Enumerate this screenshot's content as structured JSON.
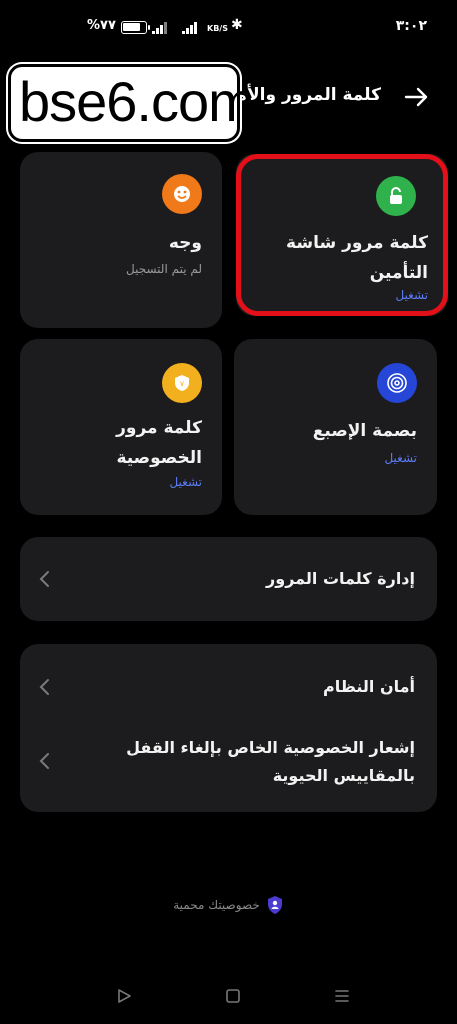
{
  "status_bar": {
    "time": "٣:٠٢",
    "battery": "%٧٧",
    "battery_level": 0.77,
    "net_speed_top": "KB/S",
    "net_speed_bottom": ""
  },
  "header": {
    "title": "كلمة المرور والأمان",
    "back_icon": "arrow-right-icon"
  },
  "watermark": {
    "text": "bse6.com"
  },
  "tiles": {
    "screen_lock": {
      "title_line1": "كلمة مرور شاشة",
      "title_line2": "التأمين",
      "status": "تشغيل",
      "icon": "lock-icon",
      "color": "#2fb24c"
    },
    "face": {
      "title": "وجه",
      "status": "لم يتم التسجيل",
      "icon": "face-icon",
      "color": "#f07a1a"
    },
    "fingerprint": {
      "title": "بصمة الإصبع",
      "status": "تشغيل",
      "icon": "fingerprint-icon",
      "color": "#2546d6"
    },
    "privacy_password": {
      "title_line1": "كلمة مرور",
      "title_line2": "الخصوصية",
      "status": "تشغيل",
      "icon": "privacy-key-icon",
      "color": "#f2b01e"
    }
  },
  "rows": {
    "password_manager": "إدارة كلمات المرور",
    "system_security": "أمان النظام",
    "biometric_notice_line1": "إشعار الخصوصية الخاص بإلغاء القفل",
    "biometric_notice_line2": "بالمقاييس الحيوية"
  },
  "footer": {
    "privacy_text": "خصوصيتك محمية",
    "privacy_icon": "shield-icon"
  },
  "navbar": {
    "back": "triangle-back-icon",
    "home": "square-home-icon",
    "recents": "menu-recents-icon"
  },
  "colors": {
    "accent": "#5b7cf5",
    "card": "#1c1c1e",
    "highlight": "#e3101a"
  }
}
